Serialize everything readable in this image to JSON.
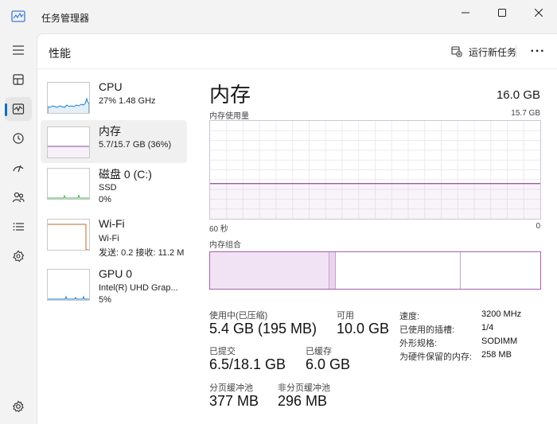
{
  "window": {
    "title": "任务管理器",
    "icons": {
      "app": "task-manager-icon",
      "minimize": "minimize-icon",
      "maximize": "maximize-icon",
      "close": "close-icon"
    }
  },
  "rail": {
    "items": [
      {
        "name": "hamburger-menu-icon"
      },
      {
        "name": "processes-icon"
      },
      {
        "name": "performance-icon",
        "active": true
      },
      {
        "name": "app-history-icon"
      },
      {
        "name": "startup-apps-icon"
      },
      {
        "name": "users-icon"
      },
      {
        "name": "details-icon"
      },
      {
        "name": "services-icon"
      },
      {
        "name": "settings-icon"
      }
    ]
  },
  "header": {
    "title": "性能",
    "new_task_label": "运行新任务",
    "more_label": "···"
  },
  "sidebar": {
    "items": [
      {
        "name": "CPU",
        "line1": "27%  1.48 GHz",
        "line2": "",
        "color": "#1d7fc8",
        "level": 0.27
      },
      {
        "name": "内存",
        "line1": "5.7/15.7 GB (36%)",
        "line2": "",
        "color": "#8f44a1",
        "level": 0.36,
        "selected": true
      },
      {
        "name": "磁盘 0 (C:)",
        "line1": "SSD",
        "line2": "0%",
        "color": "#4caf50",
        "level": 0.0
      },
      {
        "name": "Wi-Fi",
        "line1": "Wi-Fi",
        "line2": "发送: 0.2 接收: 11.2 M",
        "color": "#c26a24",
        "level": 0.0
      },
      {
        "name": "GPU 0",
        "line1": "Intel(R) UHD Grap...",
        "line2": "5%",
        "color": "#1d7fc8",
        "level": 0.05
      }
    ]
  },
  "detail": {
    "title": "内存",
    "total": "16.0 GB",
    "usage_label": "内存使用量",
    "usage_max": "15.7 GB",
    "time_left": "60 秒",
    "time_right": "0",
    "composition_label": "内存组合",
    "usage_level": 0.36,
    "composition": {
      "in_use": 0.36,
      "modified": 0.02,
      "standby": 0.38
    },
    "accent": "#8f44a1",
    "stats": {
      "in_use_label": "使用中(已压缩)",
      "in_use_value": "5.4 GB (195 MB)",
      "available_label": "可用",
      "available_value": "10.0 GB",
      "committed_label": "已提交",
      "committed_value": "6.5/18.1 GB",
      "cached_label": "已缓存",
      "cached_value": "6.0 GB",
      "paged_label": "分页缓冲池",
      "paged_value": "377 MB",
      "nonpaged_label": "非分页缓冲池",
      "nonpaged_value": "296 MB"
    },
    "props": [
      {
        "key": "速度:",
        "value": "3200 MHz"
      },
      {
        "key": "已使用的插槽:",
        "value": "1/4"
      },
      {
        "key": "外形规格:",
        "value": "SODIMM"
      },
      {
        "key": "为硬件保留的内存:",
        "value": "258 MB"
      }
    ]
  }
}
